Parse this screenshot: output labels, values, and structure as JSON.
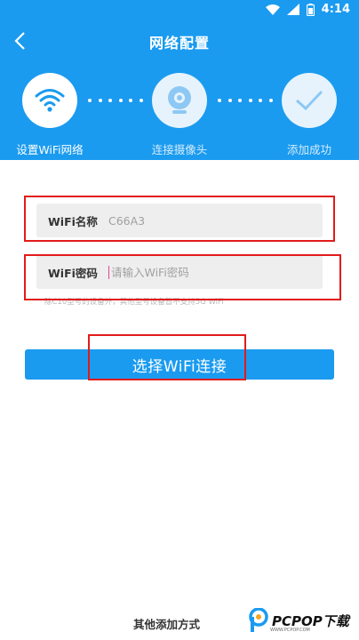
{
  "status_bar": {
    "time": "4:14",
    "icons": [
      "wifi-icon",
      "signal-icon",
      "battery-icon"
    ]
  },
  "header": {
    "title": "网络配置",
    "steps": [
      {
        "label": "设置WiFi网络",
        "icon": "wifi-icon",
        "state": "done"
      },
      {
        "label": "连接摄像头",
        "icon": "camera-icon",
        "state": "pending"
      },
      {
        "label": "添加成功",
        "icon": "check-icon",
        "state": "pending"
      }
    ]
  },
  "form": {
    "wifi_name": {
      "label": "WiFi名称",
      "value": "C66A3"
    },
    "wifi_password": {
      "label": "WiFi密码",
      "placeholder": "请输入WiFi密码"
    },
    "hint": "除C10型号的设备外，其他型号设备暂不支持5G WiFi"
  },
  "primary_button": {
    "label": "选择WiFi连接"
  },
  "footer": {
    "other_methods": "其他添加方式"
  },
  "watermark": {
    "brand": "PCPOP下载",
    "sub": "WWW.PCPOP.COM"
  },
  "colors": {
    "primary": "#1a9bf0",
    "annotation": "#e21b1b"
  }
}
